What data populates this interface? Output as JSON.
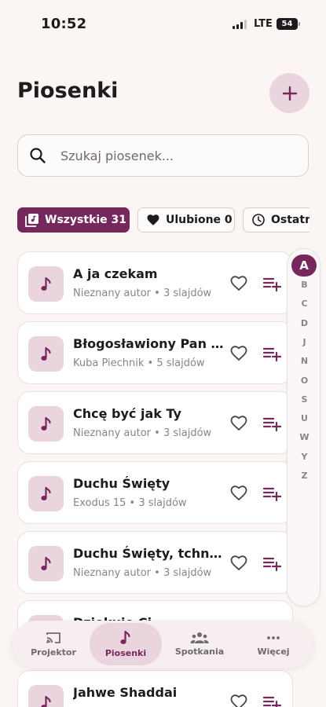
{
  "status_bar": {
    "time": "10:52",
    "network": "LTE",
    "battery": "54"
  },
  "header": {
    "title": "Piosenki"
  },
  "search": {
    "placeholder": "Szukaj piosenek..."
  },
  "filters": [
    {
      "label": "Wszystkie 31",
      "active": true
    },
    {
      "label": "Ulubione 0",
      "active": false
    },
    {
      "label": "Ostatn",
      "active": false
    }
  ],
  "songs": [
    {
      "title": "A ja czekam",
      "meta": "Nieznany autor • 3 slajdów"
    },
    {
      "title": "Błogosławiony Pan B...",
      "meta": "Kuba Piechnik • 5 slajdów"
    },
    {
      "title": "Chcę być jak Ty",
      "meta": "Nieznany autor • 3 slajdów"
    },
    {
      "title": "Duchu Święty",
      "meta": "Exodus 15 • 3 slajdów"
    },
    {
      "title": "Duchu Święty, tchnie...",
      "meta": "Nieznany autor • 3 slajdów"
    },
    {
      "title": "Dziękuję Ci",
      "meta": ""
    },
    {
      "title": "Jahwe Shaddai",
      "meta": ""
    }
  ],
  "alphabet": [
    "A",
    "B",
    "C",
    "D",
    "J",
    "N",
    "O",
    "S",
    "U",
    "W",
    "Y",
    "Z"
  ],
  "nav": [
    {
      "label": "Projektor",
      "active": false
    },
    {
      "label": "Piosenki",
      "active": true
    },
    {
      "label": "Spotkania",
      "active": false
    },
    {
      "label": "Więcej",
      "active": false
    }
  ],
  "colors": {
    "accent": "#76285d",
    "accent_light": "#ead5df",
    "background": "#fbf5f4"
  },
  "icons": {
    "add": "plus-icon",
    "search": "search-icon",
    "all": "library-icon",
    "favorites": "heart-icon",
    "recent": "clock-icon",
    "song": "music-note-icon",
    "queue": "playlist-add-icon",
    "projector": "cast-icon",
    "meetings": "group-icon",
    "more": "more-dots-icon"
  }
}
